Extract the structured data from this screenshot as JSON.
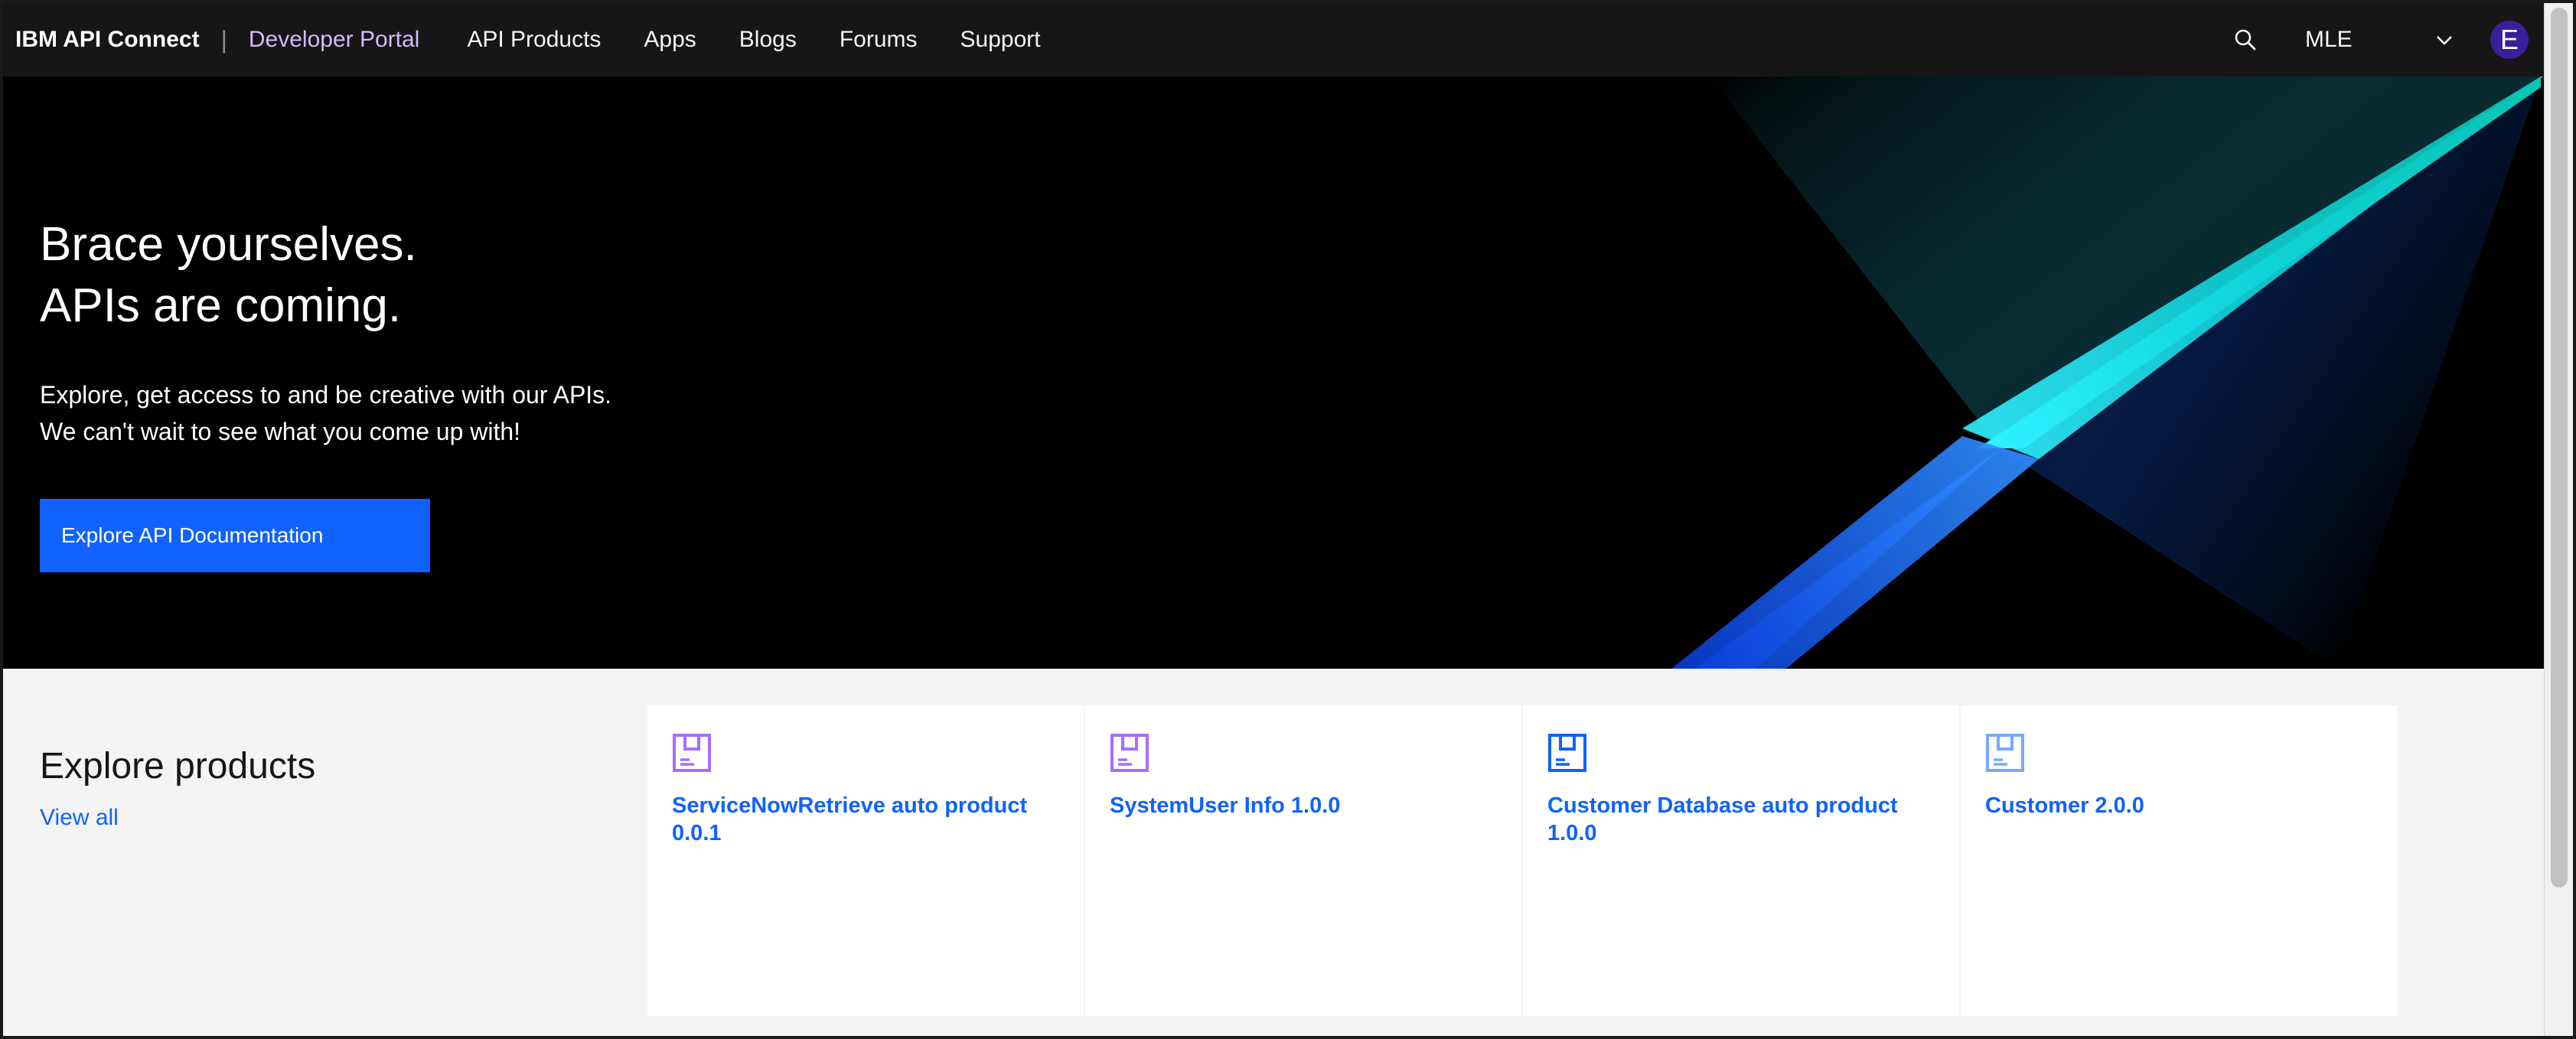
{
  "header": {
    "brand": "IBM API Connect",
    "separator": "|",
    "portal_name": "Developer Portal",
    "nav": [
      "API Products",
      "Apps",
      "Blogs",
      "Forums",
      "Support"
    ],
    "org": "MLE",
    "avatar_initial": "E",
    "icons": {
      "search": "search-icon",
      "org_menu": "chevron-down-icon"
    }
  },
  "hero": {
    "title_line1": "Brace yourselves.",
    "title_line2": "APIs are coming.",
    "subtitle_line1": "Explore, get access to and be creative with our APIs.",
    "subtitle_line2": "We can't wait to see what you come up with!",
    "cta_label": "Explore API Documentation"
  },
  "products": {
    "title": "Explore products",
    "view_all": "View all",
    "cards": [
      {
        "title_line1": "ServiceNowRetrieve auto product",
        "title_line2": "0.0.1",
        "icon": "product-box-icon",
        "icon_color": "#a56eff"
      },
      {
        "title_line1": "SystemUser Info 1.0.0",
        "title_line2": "",
        "icon": "product-box-icon",
        "icon_color": "#a56eff"
      },
      {
        "title_line1": "Customer Database auto product",
        "title_line2": "1.0.0",
        "icon": "product-box-icon",
        "icon_color": "#0f62fe"
      },
      {
        "title_line1": "Customer 2.0.0",
        "title_line2": "",
        "icon": "product-box-icon",
        "icon_color": "#78a9ff"
      }
    ]
  },
  "colors": {
    "nav_bg": "#161616",
    "portal_accent": "#d4bbff",
    "primary": "#0f62fe",
    "avatar_bg": "#3a1f9b",
    "hero_teal": "#08bdba",
    "hero_blue": "#0f62fe"
  }
}
